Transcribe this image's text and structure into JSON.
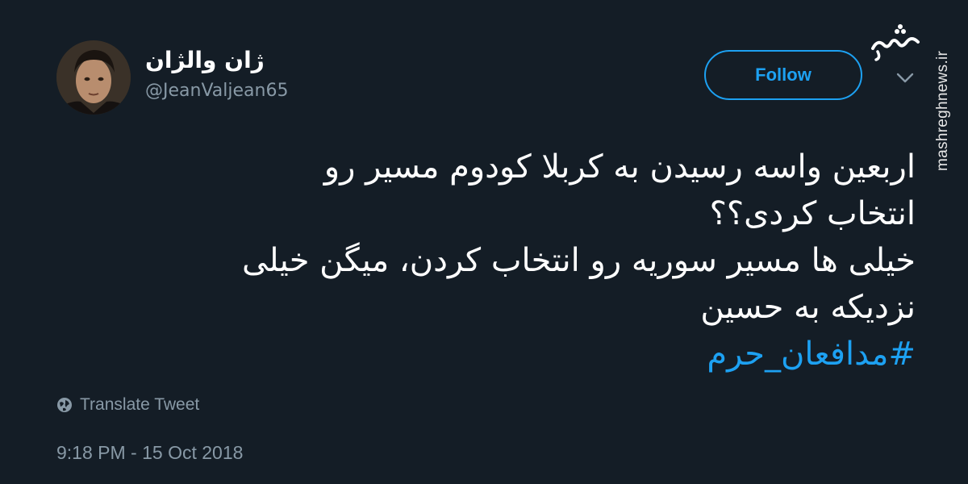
{
  "user": {
    "display_name": "ژان والژان",
    "handle": "@JeanValjean65"
  },
  "follow_button": {
    "label": "Follow"
  },
  "tweet": {
    "lines": [
      "اربعین واسه رسیدن به کربلا کودوم مسیر رو",
      "انتخاب کردی؟؟",
      "خیلی ها مسیر سوریه رو انتخاب کردن، میگن خیلی",
      "نزدیکه به حسین"
    ],
    "hashtag": "#مدافعان_حرم"
  },
  "translate": {
    "label": "Translate Tweet"
  },
  "timestamp": "9:18 PM - 15 Oct 2018",
  "watermark": {
    "logo_text": "مشرق",
    "site": "mashreghnews.ir"
  },
  "colors": {
    "background": "#141d26",
    "accent": "#1da1f2",
    "secondary_text": "#8899a6",
    "primary_text": "#ffffff"
  },
  "icons": {
    "menu": "chevron-down-icon",
    "translate": "globe-icon"
  }
}
